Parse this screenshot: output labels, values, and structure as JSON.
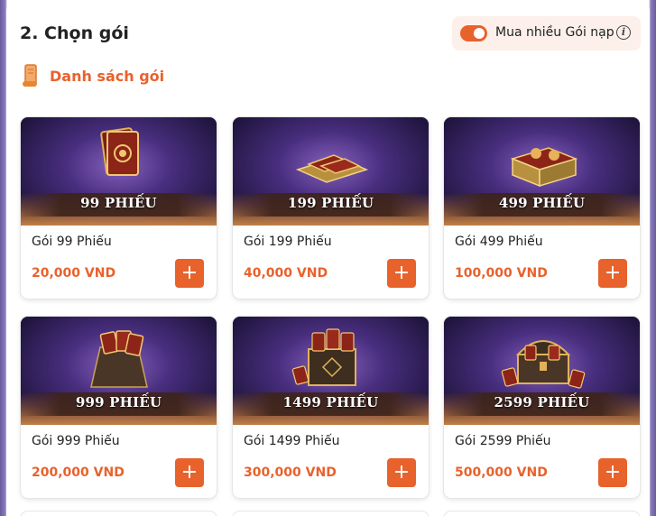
{
  "section": {
    "title": "2. Chọn gói",
    "multi_toggle_label": "Mua nhiều Gói nạp",
    "multi_toggle_on": true,
    "info_icon": "info-icon"
  },
  "list": {
    "label": "Danh sách gói",
    "icon": "scroll-icon"
  },
  "packages": [
    {
      "ticket_label": "99 PHIẾU",
      "name": "Gói 99 Phiếu",
      "price": "20,000 VND",
      "add_label": "+"
    },
    {
      "ticket_label": "199 PHIẾU",
      "name": "Gói 199 Phiếu",
      "price": "40,000 VND",
      "add_label": "+"
    },
    {
      "ticket_label": "499 PHIẾU",
      "name": "Gói 499 Phiếu",
      "price": "100,000 VND",
      "add_label": "+"
    },
    {
      "ticket_label": "999 PHIẾU",
      "name": "Gói 999 Phiếu",
      "price": "200,000 VND",
      "add_label": "+"
    },
    {
      "ticket_label": "1499 PHIẾU",
      "name": "Gói 1499 Phiếu",
      "price": "300,000 VND",
      "add_label": "+"
    },
    {
      "ticket_label": "2599 PHIẾU",
      "name": "Gói 2599 Phiếu",
      "price": "500,000 VND",
      "add_label": "+"
    }
  ],
  "colors": {
    "accent": "#e8622c",
    "toggle_bg": "#fdf0ea"
  }
}
